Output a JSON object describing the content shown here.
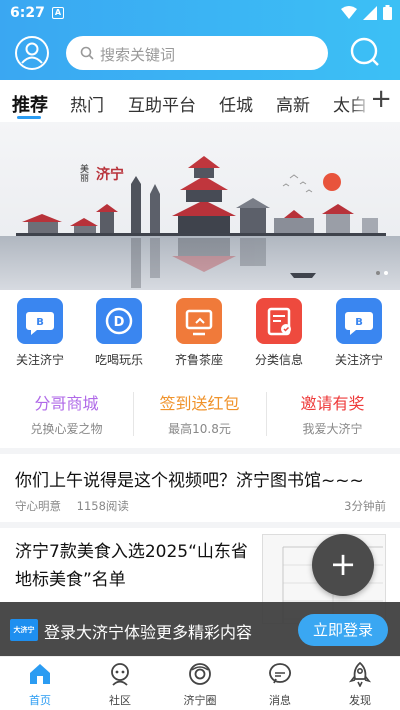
{
  "status_bar": {
    "time": "6:27",
    "a_badge": "A"
  },
  "header": {
    "search_placeholder": "搜索关键词"
  },
  "tabs": [
    {
      "label": "推荐",
      "active": true
    },
    {
      "label": "热门"
    },
    {
      "label": "互助平台"
    },
    {
      "label": "任城"
    },
    {
      "label": "高新"
    },
    {
      "label": "太白"
    }
  ],
  "tabs_add": "+",
  "banner": {
    "caption_small": "美丽",
    "caption_city": "济宁"
  },
  "quick_links": [
    {
      "label": "关注济宁",
      "icon": "chat-icon",
      "color": "#3a86f0"
    },
    {
      "label": "吃喝玩乐",
      "icon": "play-icon",
      "color": "#3a86f0"
    },
    {
      "label": "齐鲁茶座",
      "icon": "monitor-icon",
      "color": "#f07a3a"
    },
    {
      "label": "分类信息",
      "icon": "clipboard-icon",
      "color": "#ee4a3e"
    },
    {
      "label": "关注济宁",
      "icon": "chat-icon",
      "color": "#3a86f0"
    }
  ],
  "promos": [
    {
      "title": "分哥商城",
      "subtitle": "兑换心爱之物",
      "color": "#b06ae8"
    },
    {
      "title": "签到送红包",
      "subtitle": "最高10.8元",
      "color": "#f0932b"
    },
    {
      "title": "邀请有奖",
      "subtitle": "我爱大济宁",
      "color": "#ee3b3b"
    }
  ],
  "news": [
    {
      "title": "你们上午说得是这个视频吧？济宁图书馆~~~",
      "author": "守心明意",
      "reads": "1158阅读",
      "time": "3分钟前"
    },
    {
      "title": "济宁7款美食入选2025“山东省地标美食”名单"
    }
  ],
  "fab_label": "+",
  "login_bar": {
    "logo": "大济宁",
    "text": "登录大济宁体验更多精彩内容",
    "button": "立即登录"
  },
  "bottom_nav": [
    {
      "label": "首页",
      "icon": "home-icon",
      "active": true
    },
    {
      "label": "社区",
      "icon": "community-icon"
    },
    {
      "label": "济宁圈",
      "icon": "circle-icon"
    },
    {
      "label": "消息",
      "icon": "message-icon"
    },
    {
      "label": "发现",
      "icon": "rocket-icon"
    }
  ],
  "colors": {
    "accent": "#2b9cf2",
    "header": "#3aa7f2"
  }
}
